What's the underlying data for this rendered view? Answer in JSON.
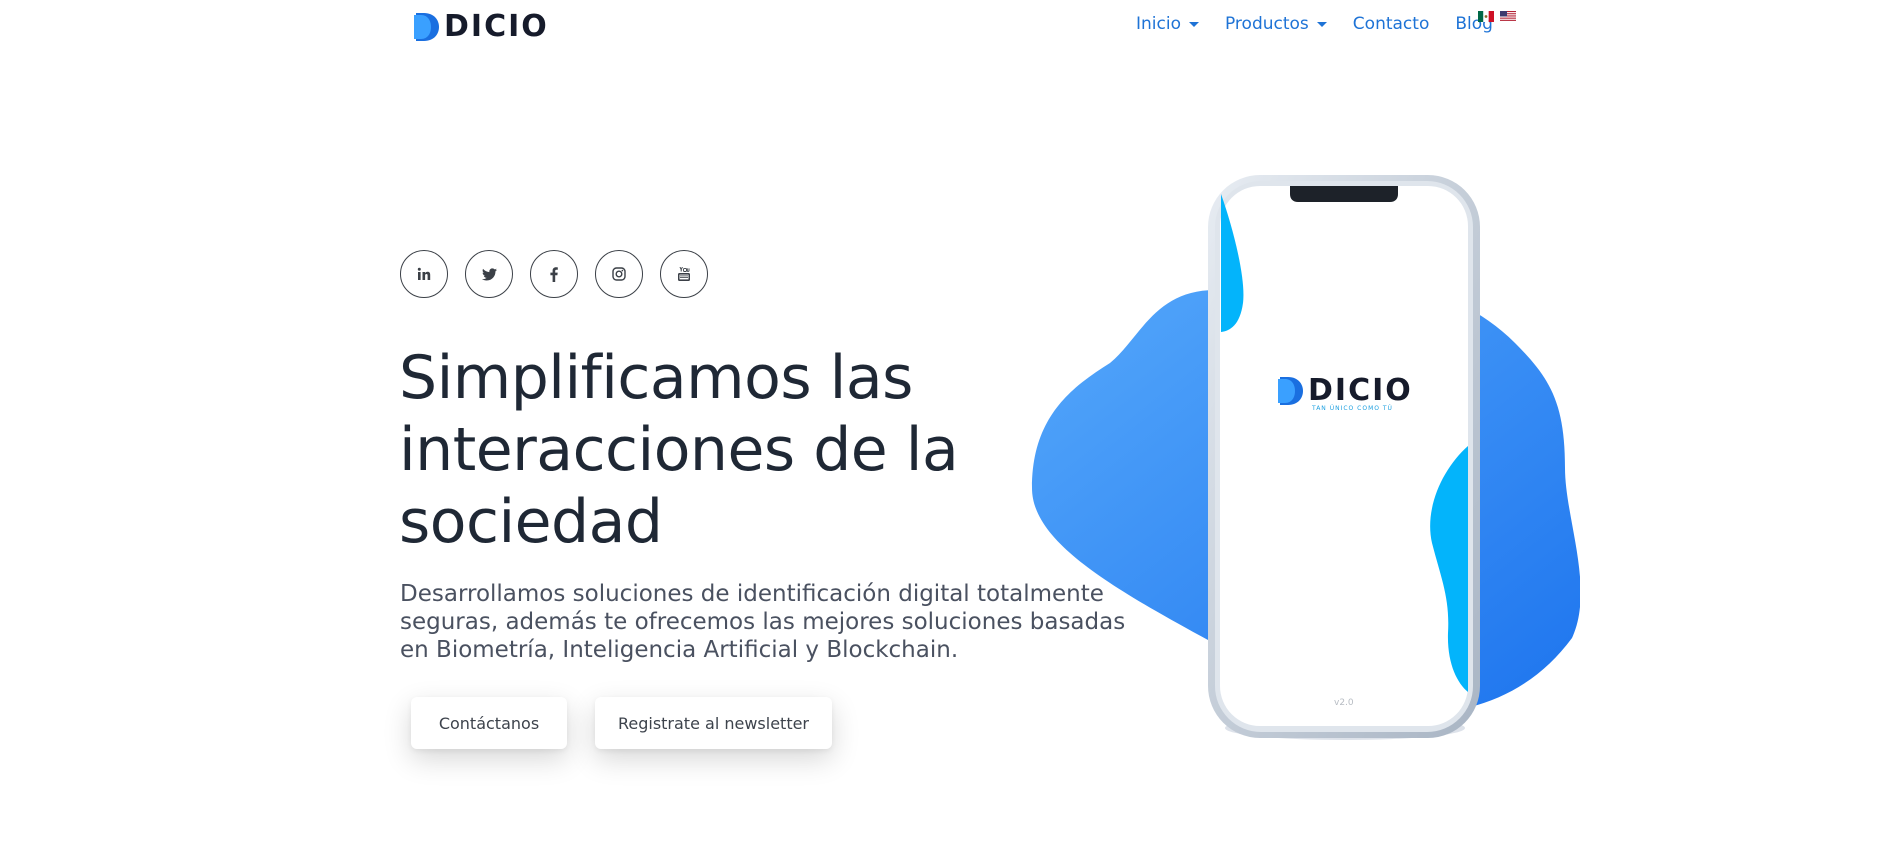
{
  "brand": {
    "name": "DICIO",
    "accent": "#1e73d6",
    "dark": "#161b2b"
  },
  "nav": {
    "items": [
      {
        "label": "Inicio",
        "dropdown": true
      },
      {
        "label": "Productos",
        "dropdown": true
      },
      {
        "label": "Contacto",
        "dropdown": false
      },
      {
        "label": "Blog",
        "dropdown": false
      }
    ],
    "flags": [
      "mexico-flag-icon",
      "usa-flag-icon"
    ]
  },
  "social": [
    "linkedin-icon",
    "twitter-icon",
    "facebook-icon",
    "instagram-icon",
    "youtube-icon"
  ],
  "hero": {
    "title_lines": [
      "Simplificamos las",
      "interacciones de la",
      "sociedad"
    ],
    "subtitle": "Desarrollamos soluciones de identificación digital totalmente seguras, además te ofrecemos las mejores soluciones basadas en Biometría, Inteligencia Artificial y Blockchain.",
    "cta_primary": "Contáctanos",
    "cta_secondary": "Registrate al newsletter"
  },
  "phone": {
    "brand": "DICIO",
    "tagline": "TAN ÚNICO COMO TÚ",
    "version": "v2.0"
  },
  "colors": {
    "blob_main": "#3d95f5",
    "blob_light": "#03b4fb",
    "text_dark": "#1f2835"
  }
}
